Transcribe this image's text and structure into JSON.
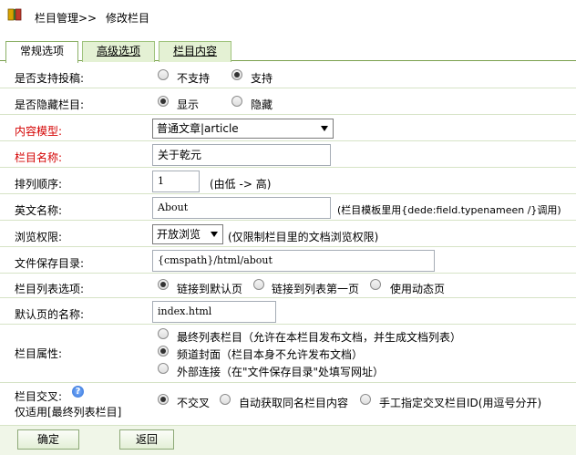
{
  "header": {
    "title": "栏目管理>>",
    "subtitle": "修改栏目",
    "icon": "book-icon"
  },
  "tabs": [
    {
      "label": "常规选项",
      "active": true
    },
    {
      "label": "高级选项",
      "active": false
    },
    {
      "label": "栏目内容",
      "active": false
    }
  ],
  "form": {
    "submit": {
      "label": "是否支持投稿:",
      "opt1": "不支持",
      "opt2": "支持",
      "selected": "支持"
    },
    "hidden": {
      "label": "是否隐藏栏目:",
      "opt1": "显示",
      "opt2": "隐藏",
      "selected": "显示"
    },
    "model": {
      "label": "内容模型:",
      "value": "普通文章|article"
    },
    "name": {
      "label": "栏目名称:",
      "value": "关于乾元"
    },
    "order": {
      "label": "排列顺序:",
      "value": "1",
      "note": "(由低 -> 高)"
    },
    "ename": {
      "label": "英文名称:",
      "value": "About",
      "note": "(栏目模板里用{dede:field.typenameen /}调用)"
    },
    "perm": {
      "label": "浏览权限:",
      "value": "开放浏览",
      "note": "(仅限制栏目里的文档浏览权限)"
    },
    "dir": {
      "label": "文件保存目录:",
      "value": "{cmspath}/html/about"
    },
    "listopt": {
      "label": "栏目列表选项:",
      "opt1": "链接到默认页",
      "opt2": "链接到列表第一页",
      "opt3": "使用动态页",
      "selected": "链接到默认页"
    },
    "defpage": {
      "label": "默认页的名称:",
      "value": "index.html"
    },
    "attr": {
      "label": "栏目属性:",
      "opt1": "最终列表栏目（允许在本栏目发布文档，并生成文档列表）",
      "opt2": "频道封面（栏目本身不允许发布文档）",
      "opt3": "外部连接（在\"文件保存目录\"处填写网址）",
      "selected": "频道封面（栏目本身不允许发布文档）"
    },
    "cross": {
      "label": "栏目交叉:",
      "label2": "仅适用[最终列表栏目]",
      "opt1": "不交叉",
      "opt2": "自动获取同名栏目内容",
      "opt3": "手工指定交叉栏目ID(用逗号分开)",
      "selected": "不交叉"
    }
  },
  "buttons": {
    "ok": "确定",
    "back": "返回"
  }
}
